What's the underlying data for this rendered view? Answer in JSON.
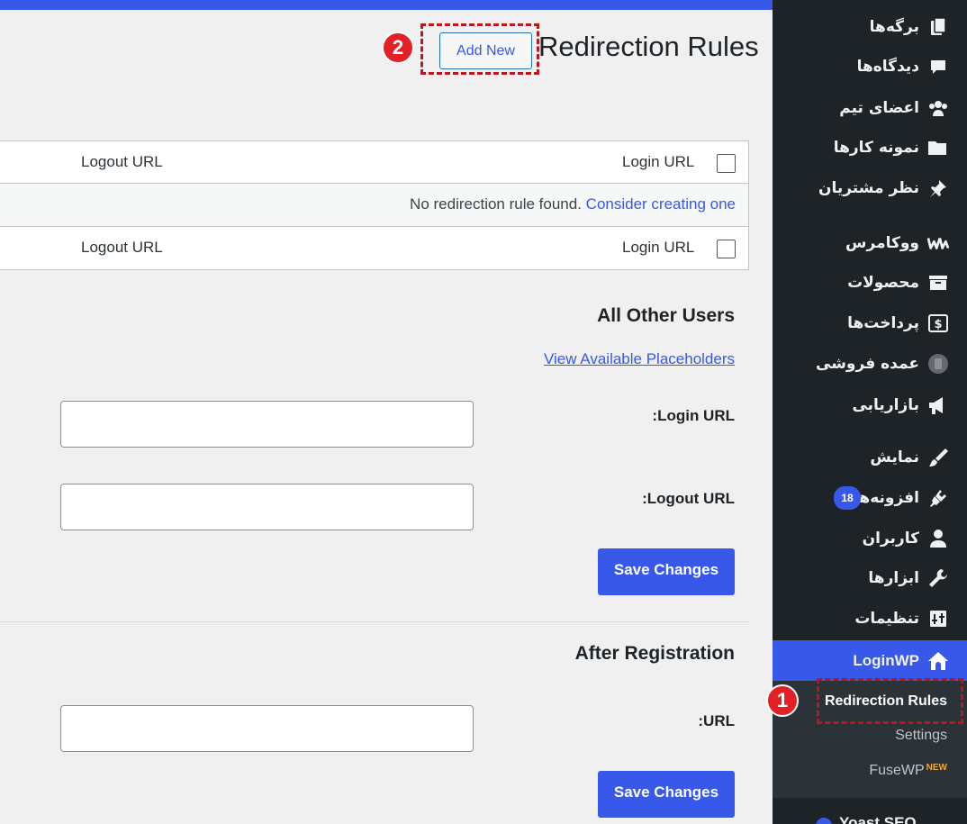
{
  "header": {
    "title": "Redirection Rules",
    "add_new_label": "Add New",
    "step_add": "2"
  },
  "table": {
    "col_login": "Login URL",
    "col_logout": "Logout URL",
    "empty_message": "No redirection rule found.",
    "empty_link": "Consider creating one"
  },
  "other_users": {
    "title": "All Other Users",
    "placeholders_link": "View Available Placeholders",
    "login_label": "Login URL:",
    "logout_label": "Logout URL:",
    "login_value": "",
    "logout_value": "",
    "save_label": "Save Changes"
  },
  "after_registration": {
    "title": "After Registration",
    "url_label": "URL:",
    "url_value": "",
    "save_label": "Save Changes"
  },
  "sidebar": {
    "items": [
      {
        "label": "برگه‌ها",
        "icon": "pages-icon"
      },
      {
        "label": "دیدگاه‌ها",
        "icon": "comments-icon"
      },
      {
        "label": "اعضای تیم",
        "icon": "team-icon"
      },
      {
        "label": "نمونه کارها",
        "icon": "portfolio-icon"
      },
      {
        "label": "نظر مشتریان",
        "icon": "pin-icon"
      },
      {
        "label": "ووکامرس",
        "icon": "woocommerce-icon"
      },
      {
        "label": "محصولات",
        "icon": "archive-icon"
      },
      {
        "label": "پرداخت‌ها",
        "icon": "payments-icon"
      },
      {
        "label": "عمده فروشی",
        "icon": "wholesale-icon"
      },
      {
        "label": "بازاریابی",
        "icon": "megaphone-icon"
      },
      {
        "label": "نمایش",
        "icon": "brush-icon"
      },
      {
        "label": "افزونه‌ها",
        "icon": "plugin-icon",
        "badge": "18"
      },
      {
        "label": "کاربران",
        "icon": "user-icon"
      },
      {
        "label": "ابزارها",
        "icon": "wrench-icon"
      },
      {
        "label": "تنظیمات",
        "icon": "settings-icon"
      },
      {
        "label": "LoginWP",
        "icon": "home-icon"
      }
    ],
    "submenu": {
      "redirection_rules": "Redirection Rules",
      "settings": "Settings",
      "fusewp": "FuseWP",
      "fusewp_badge": "NEW"
    },
    "step_redirect": "1",
    "seo_label": "Yoast SEO"
  },
  "colors": {
    "accent": "#3858e9",
    "sidebar_bg": "#1d2327",
    "highlight": "#c0141b"
  }
}
